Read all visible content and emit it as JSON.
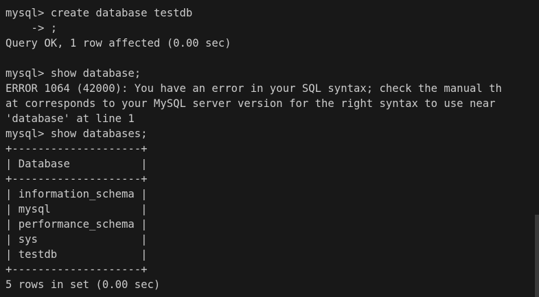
{
  "terminal": {
    "lines": [
      "mysql> create database testdb",
      "    -> ;",
      "Query OK, 1 row affected (0.00 sec)",
      "",
      "mysql> show database;",
      "ERROR 1064 (42000): You have an error in your SQL syntax; check the manual th",
      "at corresponds to your MySQL server version for the right syntax to use near",
      "'database' at line 1",
      "mysql> show databases;",
      "+--------------------+",
      "| Database           |",
      "+--------------------+",
      "| information_schema |",
      "| mysql              |",
      "| performance_schema |",
      "| sys                |",
      "| testdb             |",
      "+--------------------+",
      "5 rows in set (0.00 sec)"
    ]
  },
  "colors": {
    "background": "#181818",
    "text": "#cccccc",
    "scrollbar_thumb": "#3a3a3a"
  }
}
